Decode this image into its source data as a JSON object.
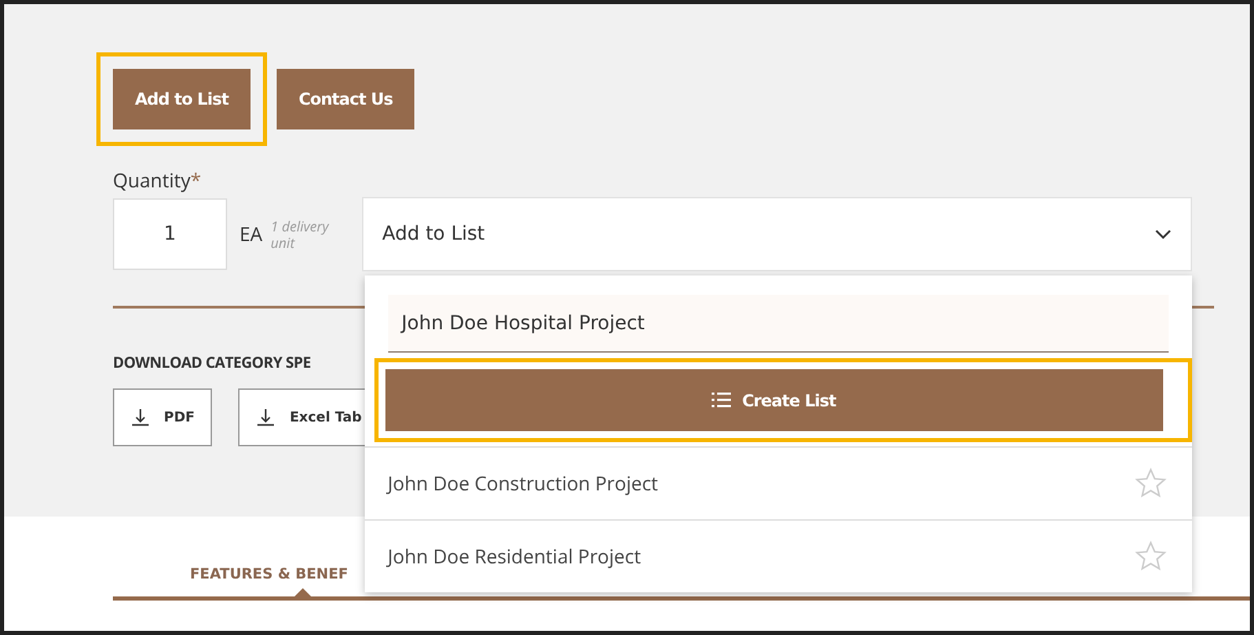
{
  "actions": [
    {
      "label": "Add to List",
      "highlighted": true
    },
    {
      "label": "Contact Us",
      "highlighted": false
    }
  ],
  "quantity": {
    "label": "Quantity",
    "required_mark": "*",
    "value": "1",
    "unit": "EA",
    "unit_note": "1 delivery unit"
  },
  "list_select": {
    "value": "Add to List",
    "expanded": true,
    "new_list_field": {
      "value": "John Doe Hospital Project"
    },
    "create_button": {
      "label": "Create List",
      "highlighted": true
    },
    "lists": [
      {
        "name": "John Doe Construction Project",
        "favorite": false
      },
      {
        "name": "John Doe Residential Project",
        "favorite": false
      }
    ]
  },
  "downloads": {
    "heading": "DOWNLOAD CATEGORY SPE",
    "buttons": [
      {
        "label": "PDF"
      },
      {
        "label": "Excel Tab"
      }
    ]
  },
  "tabs": [
    {
      "label": "FEATURES & BENEF",
      "selected": true
    }
  ]
}
